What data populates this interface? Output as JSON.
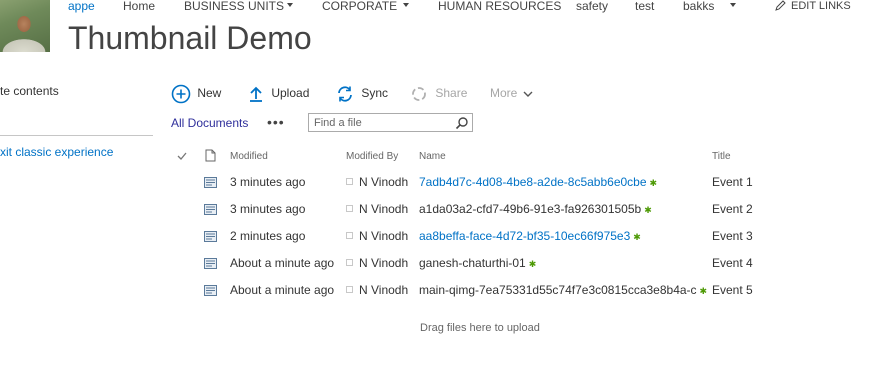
{
  "site": {
    "logo_alt": "site logo"
  },
  "topnav": {
    "items": [
      {
        "label": "appe",
        "current": true
      },
      {
        "label": "Home"
      },
      {
        "label": "BUSINESS UNITS",
        "dropdown": true
      },
      {
        "label": "CORPORATE",
        "dropdown": true
      },
      {
        "label": "HUMAN RESOURCES"
      },
      {
        "label": "safety"
      },
      {
        "label": "test"
      },
      {
        "label": "bakks",
        "dropdown": true
      }
    ],
    "edit_links": "EDIT LINKS"
  },
  "page": {
    "title": "Thumbnail Demo"
  },
  "leftnav": {
    "site_contents": "te contents",
    "exit_classic": "xit classic experience"
  },
  "commands": {
    "new": "New",
    "upload": "Upload",
    "sync": "Sync",
    "share": "Share",
    "more": "More"
  },
  "views": {
    "current": "All Documents",
    "more_options": "•••",
    "search_placeholder": "Find a file"
  },
  "table": {
    "headers": {
      "modified": "Modified",
      "modified_by": "Modified By",
      "name": "Name",
      "title": "Title"
    },
    "rows": [
      {
        "modified": "3 minutes ago",
        "modified_by": "N Vinodh",
        "name": "7adb4d7c-4d08-4be8-a2de-8c5abb6e0cbe",
        "title": "Event 1",
        "is_link": true
      },
      {
        "modified": "3 minutes ago",
        "modified_by": "N Vinodh",
        "name": "a1da03a2-cfd7-49b6-91e3-fa926301505b",
        "title": "Event 2",
        "is_link": false
      },
      {
        "modified": "2 minutes ago",
        "modified_by": "N Vinodh",
        "name": "aa8beffa-face-4d72-bf35-10ec66f975e3",
        "title": "Event 3",
        "is_link": true
      },
      {
        "modified": "About a minute ago",
        "modified_by": "N Vinodh",
        "name": "ganesh-chaturthi-01",
        "title": "Event 4",
        "is_link": false
      },
      {
        "modified": "About a minute ago",
        "modified_by": "N Vinodh",
        "name": "main-qimg-7ea75331d55c74f7e3c0815cca3e8b4a-c",
        "title": "Event 5",
        "is_link": false
      }
    ],
    "new_badge": "✱"
  },
  "drop_hint": "Drag files here to upload",
  "colors": {
    "accent": "#0072c6",
    "view_tab": "#2f2f9b",
    "new_badge": "#4e9a06"
  }
}
